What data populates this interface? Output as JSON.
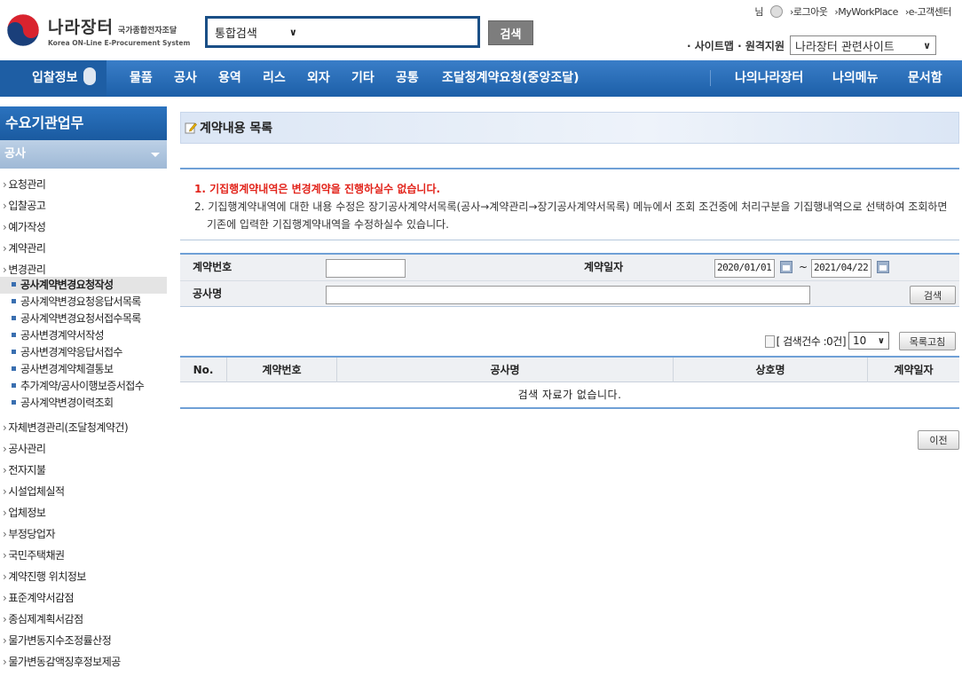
{
  "header": {
    "logo_title": "나라장터",
    "logo_sub": "국가종합전자조달",
    "logo_en": "Korea ON-Line E-Procurement System",
    "search_select_value": "통합검색",
    "search_button": "검색",
    "top_links": {
      "user_suffix": "님",
      "logout": "›로그아웃",
      "myworkplace": "›MyWorkPlace",
      "customer_center": "›e-고객센터"
    },
    "site_links": "· 사이트맵 · 원격지원",
    "related_select_value": "나라장터 관련사이트"
  },
  "nav": {
    "items": [
      "입찰정보",
      "물품",
      "공사",
      "용역",
      "리스",
      "외자",
      "기타",
      "공통",
      "조달청계약요청(중앙조달)"
    ],
    "right_items": [
      "나의나라장터",
      "나의메뉴",
      "문서함"
    ]
  },
  "sidebar": {
    "title": "수요기관업무",
    "section": "공사",
    "items_top": [
      "요청관리",
      "입찰공고",
      "예가작성",
      "계약관리",
      "변경관리"
    ],
    "sub_items": [
      "공사계약변경요청작성",
      "공사계약변경요청응답서목록",
      "공사계약변경요청서접수목록",
      "공사변경계약서작성",
      "공사변경계약응답서접수",
      "공사변경계약체결통보",
      "추가계약/공사이행보증서접수",
      "공사계약변경이력조회"
    ],
    "items_bottom": [
      "자체변경관리(조달청계약건)",
      "공사관리",
      "전자지불",
      "시설업체실적",
      "업체정보",
      "부정당업자",
      "국민주택채권",
      "계약진행 위치정보",
      "표준계약서감점",
      "종심제계획서감점",
      "물가변동지수조정률산정",
      "물가변동감액징후정보제공"
    ]
  },
  "main": {
    "page_title": "계약내용 목록",
    "notice_1": "1. 기집행계약내역은 변경계약을 진행하실수 없습니다.",
    "notice_2": "2. 기집행계약내역에 대한 내용 수정은 장기공사계약서목록(공사→계약관리→장기공사계약서목록) 메뉴에서 조회 조건중에 처리구분을 기집행내역으로 선택하여 조회하면 기존에 입력한 기집행계약내역을 수정하실수 있습니다.",
    "form": {
      "contract_no_label": "계약번호",
      "contract_no_value": "",
      "contract_date_label": "계약일자",
      "date_from": "2020/01/01",
      "date_sep": "~",
      "date_to": "2021/04/22",
      "project_name_label": "공사명",
      "project_name_value": "",
      "search_button": "검색"
    },
    "count_text": "[ 검색건수 :0건]",
    "per_page": "10",
    "refresh_button": "목록고침",
    "table": {
      "headers": [
        "No.",
        "계약번호",
        "공사명",
        "상호명",
        "계약일자"
      ],
      "empty_message": "검색 자료가 없습니다."
    },
    "prev_button": "이전"
  }
}
